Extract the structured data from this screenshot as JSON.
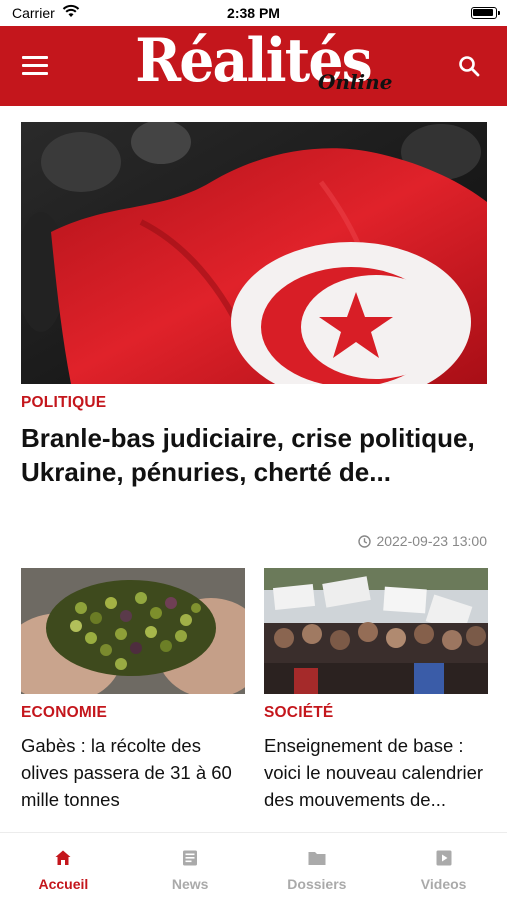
{
  "status_bar": {
    "carrier": "Carrier",
    "time": "2:38 PM"
  },
  "header": {
    "logo_main": "Réalités",
    "logo_sub": "Online"
  },
  "featured": {
    "category": "POLITIQUE",
    "title": "Branle-bas judiciaire, crise politique, Ukraine, pénuries, cherté de...",
    "date": "2022-09-23 13:00"
  },
  "cards": [
    {
      "category": "ECONOMIE",
      "title": "Gabès : la récolte des olives passera de 31 à 60 mille tonnes"
    },
    {
      "category": "SOCIÉTÉ",
      "title": "Enseignement de base : voici le nouveau calendrier des mouvements de..."
    }
  ],
  "tabs": [
    {
      "label": "Accueil",
      "icon": "home-icon",
      "active": true
    },
    {
      "label": "News",
      "icon": "news-icon",
      "active": false
    },
    {
      "label": "Dossiers",
      "icon": "folder-icon",
      "active": false
    },
    {
      "label": "Videos",
      "icon": "video-icon",
      "active": false
    }
  ],
  "colors": {
    "brand": "#c4161c",
    "inactive": "#aaaaaa",
    "meta": "#888888"
  }
}
